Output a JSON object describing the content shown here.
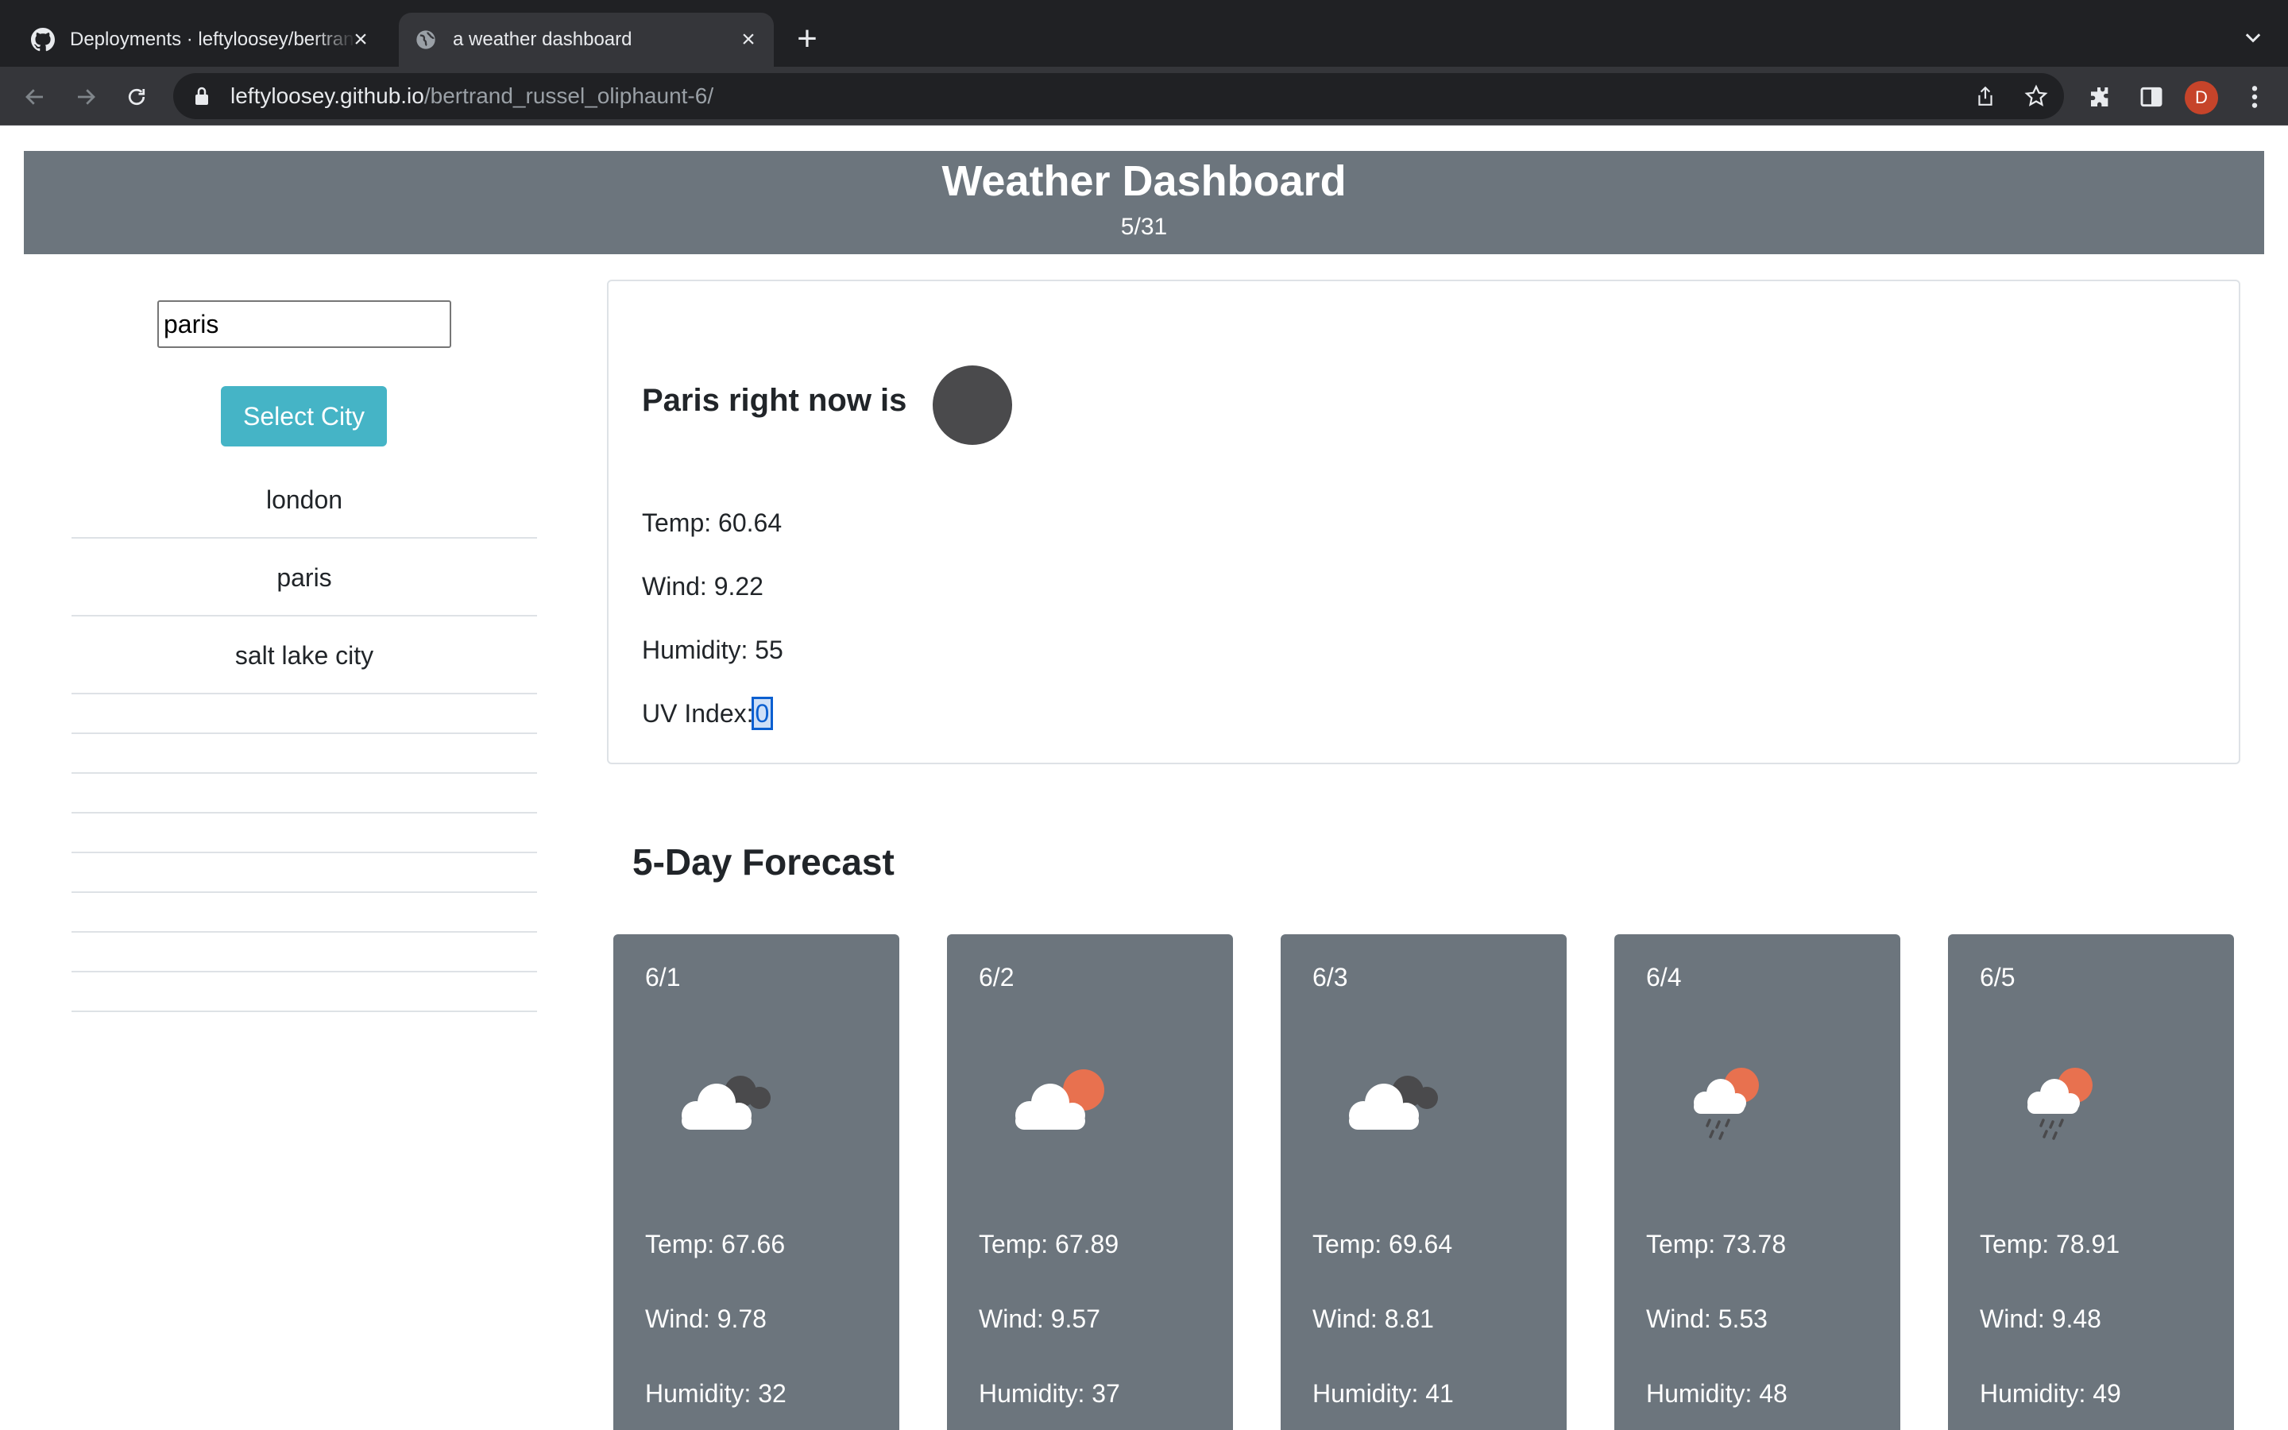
{
  "browser": {
    "tabs": [
      {
        "title": "Deployments · leftyloosey/bertrand_russel_oliphaunt-6",
        "favicon": "github-icon"
      },
      {
        "title": "a weather dashboard",
        "favicon": "globe-icon"
      }
    ],
    "url_host": "leftyloosey.github.io",
    "url_path": "/bertrand_russel_oliphaunt-6/",
    "profile_initial": "D"
  },
  "header": {
    "title": "Weather Dashboard",
    "date": "5/31"
  },
  "search": {
    "value": "paris",
    "button_label": "Select City"
  },
  "history": {
    "cities": [
      "london",
      "paris",
      "salt lake city"
    ],
    "empty_slots": 8
  },
  "current": {
    "heading": "Paris right now is",
    "icon": "dark-circle-icon",
    "temp": "Temp: 60.64",
    "wind": "Wind: 9.22",
    "humidity": "Humidity: 55",
    "uv_label": "UV Index:",
    "uv_value": "0"
  },
  "forecast": {
    "title": "5-Day Forecast",
    "days": [
      {
        "date": "6/1",
        "icon": "broken-clouds-icon",
        "temp": "Temp: 67.66",
        "wind": "Wind: 9.78",
        "humidity": "Humidity: 32"
      },
      {
        "date": "6/2",
        "icon": "few-clouds-icon",
        "temp": "Temp: 67.89",
        "wind": "Wind: 9.57",
        "humidity": "Humidity: 37"
      },
      {
        "date": "6/3",
        "icon": "broken-clouds-icon",
        "temp": "Temp: 69.64",
        "wind": "Wind: 8.81",
        "humidity": "Humidity: 41"
      },
      {
        "date": "6/4",
        "icon": "rain-sun-icon",
        "temp": "Temp: 73.78",
        "wind": "Wind: 5.53",
        "humidity": "Humidity: 48"
      },
      {
        "date": "6/5",
        "icon": "rain-sun-icon",
        "temp": "Temp: 78.91",
        "wind": "Wind: 9.48",
        "humidity": "Humidity: 49"
      }
    ]
  },
  "colors": {
    "header_bg": "#6c757d",
    "button_bg": "#17a2b8",
    "card_bg": "#6c757d",
    "sun": "#e8714f"
  }
}
